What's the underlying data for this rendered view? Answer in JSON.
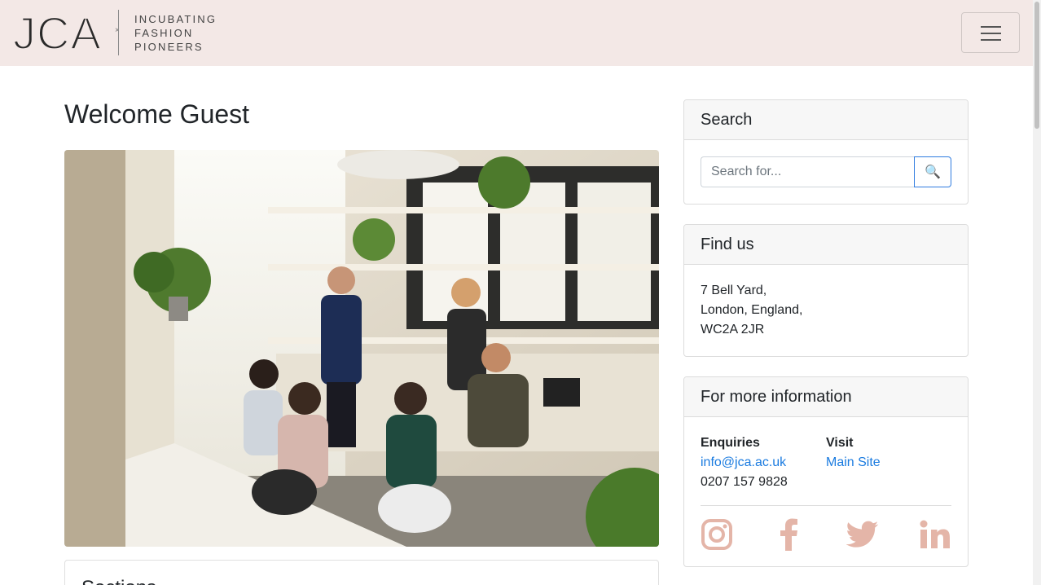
{
  "header": {
    "logo_text": "JCA",
    "tagline": [
      "INCUBATING",
      "FASHION",
      "PIONEERS"
    ],
    "menu_icon": "hamburger-icon"
  },
  "main": {
    "title": "Welcome Guest",
    "sections_title": "Sections"
  },
  "search": {
    "title": "Search",
    "placeholder": "Search for...",
    "button_icon": "🔍"
  },
  "find_us": {
    "title": "Find us",
    "address_lines": [
      "7 Bell Yard,",
      "London, England,",
      "WC2A 2JR"
    ]
  },
  "more_info": {
    "title": "For more information",
    "enquiries_label": "Enquiries",
    "email": "info@jca.ac.uk",
    "phone": "0207 157 9828",
    "visit_label": "Visit",
    "main_site": "Main Site",
    "socials": [
      "instagram-icon",
      "facebook-icon",
      "twitter-icon",
      "linkedin-icon"
    ]
  },
  "colors": {
    "navbar_bg": "#f3e8e6",
    "social_icon": "#e4b5a8",
    "link": "#1a7be0"
  }
}
